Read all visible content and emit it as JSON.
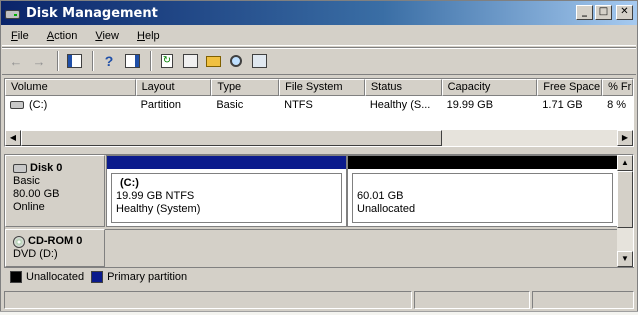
{
  "window": {
    "title": "Disk Management",
    "controls": {
      "minimize": "_",
      "restore": "□",
      "close": "✕"
    }
  },
  "menu": [
    {
      "label": "File",
      "mnemonic": "F",
      "rest": "ile"
    },
    {
      "label": "Action",
      "mnemonic": "A",
      "rest": "ction"
    },
    {
      "label": "View",
      "mnemonic": "V",
      "rest": "iew"
    },
    {
      "label": "Help",
      "mnemonic": "H",
      "rest": "elp"
    }
  ],
  "toolbar": {
    "icons": [
      "back-arrow-icon",
      "forward-arrow-icon",
      "show-hide-console-tree-icon",
      "help-icon",
      "action-pane-icon",
      "refresh-icon",
      "properties-icon",
      "open-folder-icon",
      "explore-icon",
      "settings-icon"
    ]
  },
  "volume_list": {
    "columns": [
      "Volume",
      "Layout",
      "Type",
      "File System",
      "Status",
      "Capacity",
      "Free Space",
      "% Fr"
    ],
    "rows": [
      {
        "volume": "(C:)",
        "layout": "Partition",
        "type": "Basic",
        "file_system": "NTFS",
        "status": "Healthy (S...",
        "capacity": "19.99 GB",
        "free_space": "1.71 GB",
        "percent_free": "8 %"
      }
    ]
  },
  "disks": [
    {
      "name": "Disk 0",
      "type": "Basic",
      "size": "80.00 GB",
      "state": "Online",
      "partitions": [
        {
          "name": "(C:)",
          "size_fs": "19.99 GB NTFS",
          "status": "Healthy (System)",
          "kind": "primary"
        },
        {
          "name": "",
          "size_fs": "60.01 GB",
          "status": "Unallocated",
          "kind": "unallocated"
        }
      ]
    },
    {
      "name": "CD-ROM 0",
      "type_drive": "DVD (D:)"
    }
  ],
  "legend": [
    {
      "label": "Unallocated",
      "color": "#000000"
    },
    {
      "label": "Primary partition",
      "color": "#0a1a8c"
    }
  ],
  "colors": {
    "title_start": "#0a246a",
    "primary_partition": "#0a1a8c",
    "unallocated": "#000000",
    "chrome": "#d4d0c8"
  }
}
